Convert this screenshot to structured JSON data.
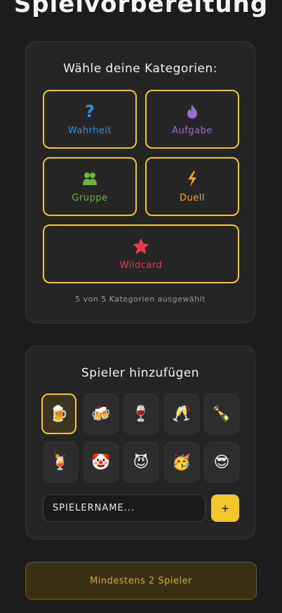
{
  "page": {
    "title": "Spielvorbereitung"
  },
  "categories": {
    "heading": "Wähle deine Kategorien:",
    "items": [
      {
        "label": "Wahrheit",
        "icon": "question-icon",
        "color": "#2f8ee0"
      },
      {
        "label": "Aufgabe",
        "icon": "flame-icon",
        "color": "#9a6dd0"
      },
      {
        "label": "Gruppe",
        "icon": "group-icon",
        "color": "#6ab63a"
      },
      {
        "label": "Duell",
        "icon": "lightning-icon",
        "color": "#f2a81e"
      },
      {
        "label": "Wildcard",
        "icon": "star-icon",
        "color": "#e8394f"
      }
    ],
    "count_text": "5 von 5 Kategorien ausgewählt",
    "selected_border_color": "#f2c72e"
  },
  "players": {
    "heading": "Spieler hinzufügen",
    "avatars": [
      "🍺",
      "🍻",
      "🍷",
      "🥂",
      "🍾",
      "🍹",
      "🤡",
      "😈",
      "🥳",
      "😎"
    ],
    "selected_avatar_index": 0,
    "name_placeholder": "SPIELERNAME...",
    "add_button": "+"
  },
  "start": {
    "label": "Mindestens 2 Spieler"
  }
}
